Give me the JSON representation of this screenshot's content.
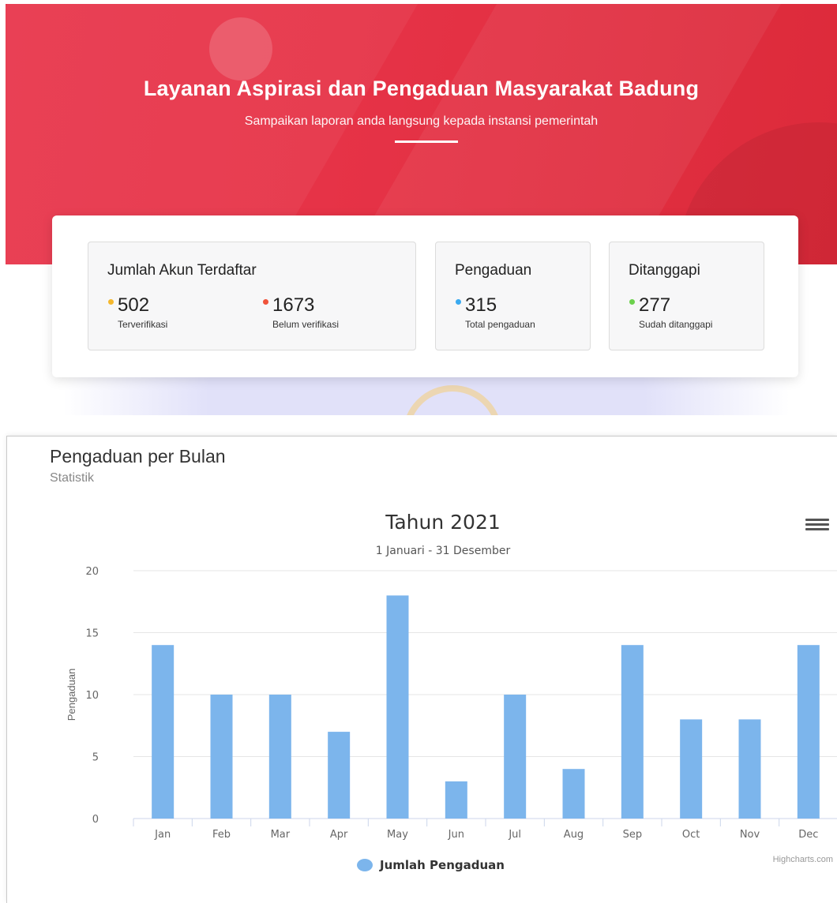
{
  "hero": {
    "title": "Layanan Aspirasi dan Pengaduan Masyarakat Badung",
    "subtitle": "Sampaikan laporan anda langsung kepada instansi pemerintah"
  },
  "stats": {
    "accounts": {
      "title": "Jumlah Akun Terdaftar",
      "verified": {
        "value": "502",
        "label": "Terverifikasi",
        "color": "#f5b82e"
      },
      "unverified": {
        "value": "1673",
        "label": "Belum verifikasi",
        "color": "#f0533b"
      }
    },
    "complaints": {
      "title": "Pengaduan",
      "total": {
        "value": "315",
        "label": "Total pengaduan",
        "color": "#3aaaf0"
      }
    },
    "responded": {
      "title": "Ditanggapi",
      "done": {
        "value": "277",
        "label": "Sudah ditanggapi",
        "color": "#6cd14d"
      }
    }
  },
  "panel": {
    "title": "Pengaduan per Bulan",
    "subtitle": "Statistik",
    "menu_icon": "hamburger-menu-icon",
    "credits": "Highcharts.com"
  },
  "chart_data": {
    "type": "bar",
    "title": "Tahun 2021",
    "subtitle": "1 Januari - 31 Desember",
    "ylabel": "Pengaduan",
    "xlabel": "",
    "categories": [
      "Jan",
      "Feb",
      "Mar",
      "Apr",
      "May",
      "Jun",
      "Jul",
      "Aug",
      "Sep",
      "Oct",
      "Nov",
      "Dec"
    ],
    "series": [
      {
        "name": "Jumlah Pengaduan",
        "values": [
          14,
          10,
          10,
          7,
          18,
          3,
          10,
          4,
          14,
          8,
          8,
          14
        ],
        "color": "#7cb5ec"
      }
    ],
    "ylim": [
      0,
      20
    ],
    "yticks": [
      0,
      5,
      10,
      15,
      20
    ],
    "grid": true,
    "legend": "bottom-center"
  }
}
